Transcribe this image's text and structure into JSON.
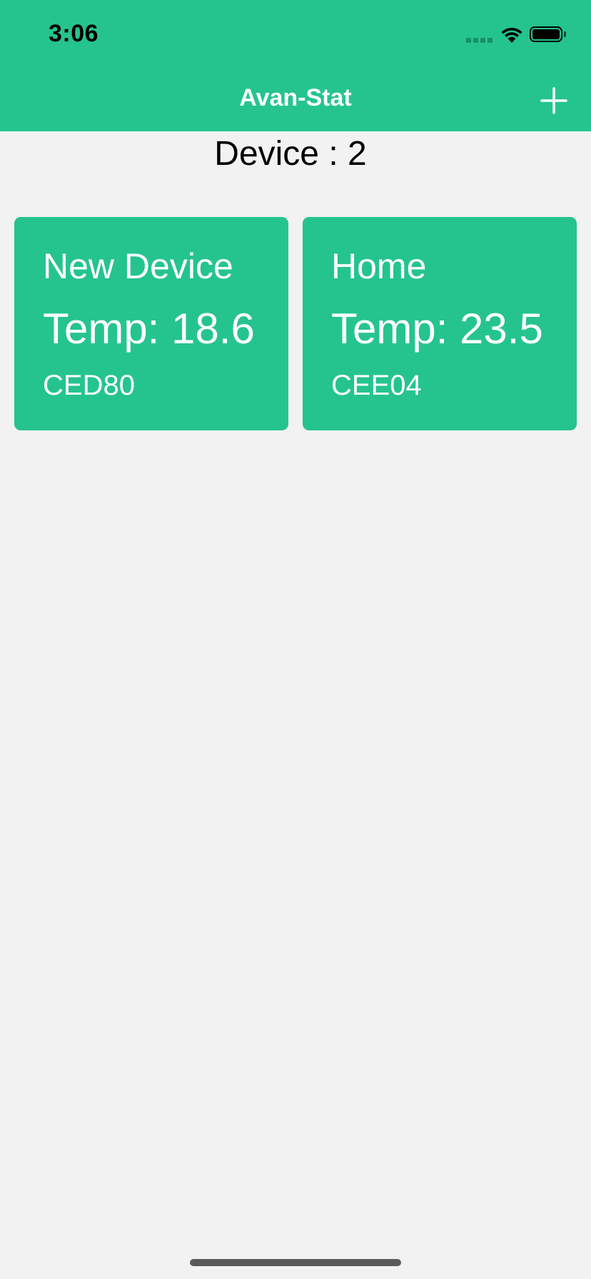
{
  "status_bar": {
    "time": "3:06",
    "icons": [
      "signal-icon",
      "wifi-icon",
      "battery-icon"
    ]
  },
  "header": {
    "title": "Avan-Stat",
    "add_icon": "plus-icon",
    "background_color": "#25c48e"
  },
  "summary": {
    "device_count_text": "Device : 2"
  },
  "devices": [
    {
      "name": "New Device",
      "temp": "Temp: 18.6",
      "code": "CED80"
    },
    {
      "name": "Home",
      "temp": "Temp: 23.5",
      "code": "CEE04"
    }
  ],
  "colors": {
    "accent": "#25c48e",
    "background": "#f2f2f2",
    "card_text": "#ffffff"
  }
}
